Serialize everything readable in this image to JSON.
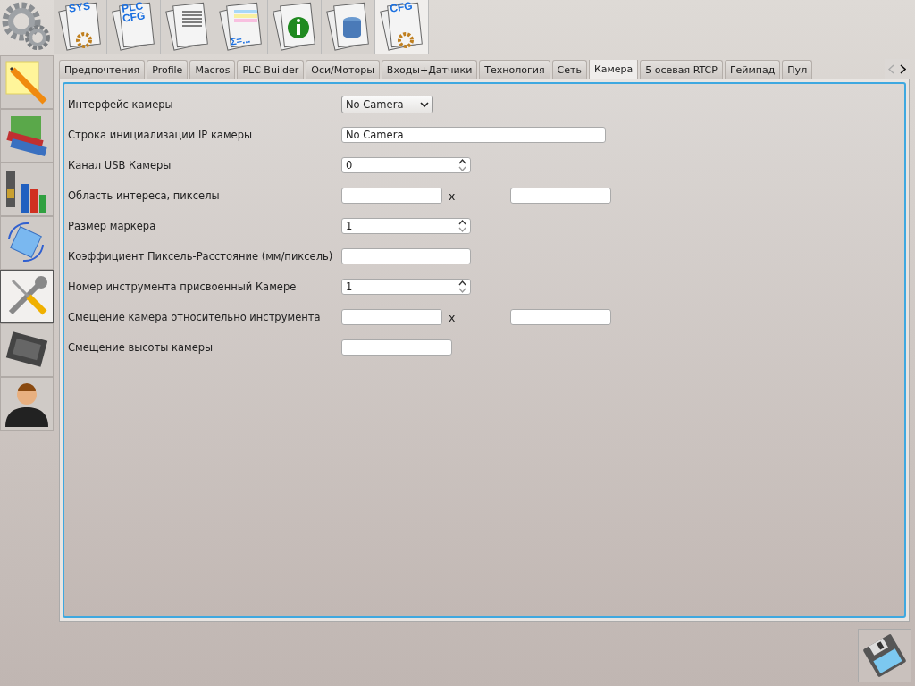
{
  "toolbar": [
    {
      "text": "SYS",
      "selected": false
    },
    {
      "text": "PLC CFG",
      "selected": false
    },
    {
      "selected": false
    },
    {
      "text": "Σ=...",
      "selected": false
    },
    {
      "selected": false
    },
    {
      "selected": false
    },
    {
      "text": "CFG",
      "selected": true
    }
  ],
  "sidebar": {
    "items": [
      {
        "selected": false
      },
      {
        "selected": false
      },
      {
        "selected": false
      },
      {
        "selected": false
      },
      {
        "selected": true
      },
      {
        "selected": false
      },
      {
        "selected": false
      }
    ]
  },
  "tabs": [
    {
      "label": "Предпочтения",
      "selected": false
    },
    {
      "label": "Profile",
      "selected": false
    },
    {
      "label": "Macros",
      "selected": false
    },
    {
      "label": "PLC Builder",
      "selected": false
    },
    {
      "label": "Оси/Моторы",
      "selected": false
    },
    {
      "label": "Входы+Датчики",
      "selected": false
    },
    {
      "label": "Технология",
      "selected": false
    },
    {
      "label": "Сеть",
      "selected": false
    },
    {
      "label": "Камера",
      "selected": true
    },
    {
      "label": "5 осевая RTCP",
      "selected": false
    },
    {
      "label": "Геймпад",
      "selected": false
    },
    {
      "label": "Пул",
      "selected": false
    }
  ],
  "form": [
    {
      "kind": "combo",
      "label": "Интерфейс камеры",
      "value": "No Camera"
    },
    {
      "kind": "text",
      "label": "Строка инициализации IP камеры",
      "value": "No Camera"
    },
    {
      "kind": "spin",
      "label": "Канал USB Камеры",
      "value": "0"
    },
    {
      "kind": "pair",
      "label": "Область интереса, пикселы",
      "separator": "x"
    },
    {
      "kind": "spin",
      "label": "Размер маркера",
      "value": "1"
    },
    {
      "kind": "field",
      "label": "Коэффициент Пиксель-Расстояние (мм/пиксель)"
    },
    {
      "kind": "spin",
      "label": "Номер инструмента присвоенный Камере",
      "value": "1"
    },
    {
      "kind": "pair",
      "label": "Смещение камера относительно инструмента",
      "separator": "x"
    },
    {
      "kind": "short",
      "label": "Смещение высоты камеры"
    }
  ]
}
